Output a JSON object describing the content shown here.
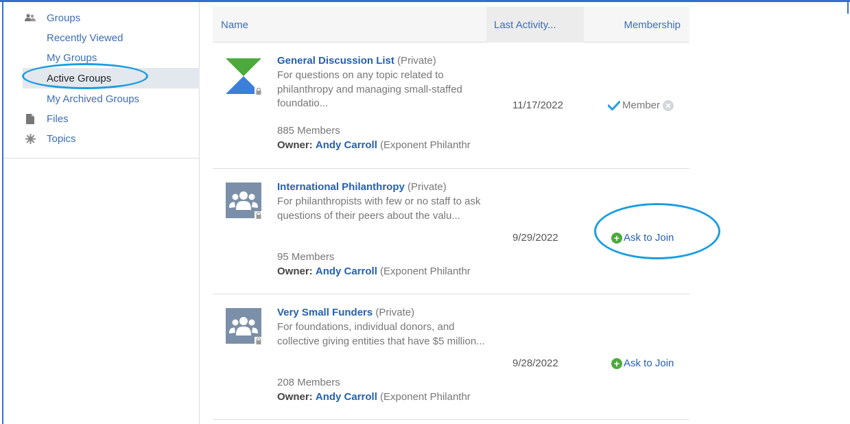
{
  "sidebar": {
    "items": [
      {
        "label": "Groups",
        "icon": "groups-icon"
      },
      {
        "label": "Recently Viewed"
      },
      {
        "label": "My Groups"
      },
      {
        "label": "Active Groups",
        "active": true
      },
      {
        "label": "My Archived Groups"
      },
      {
        "label": "Files",
        "icon": "file-icon"
      },
      {
        "label": "Topics",
        "icon": "topics-icon"
      }
    ]
  },
  "table": {
    "headers": {
      "name": "Name",
      "last_activity": "Last Activity...",
      "membership": "Membership"
    },
    "rows": [
      {
        "title": "General Discussion List",
        "privacy": "(Private)",
        "description": "For questions on any topic related to philanthropy and managing small-staffed foundatio...",
        "members": "885 Members",
        "owner_label": "Owner:",
        "owner_name": "Andy Carroll",
        "owner_org": "(Exponent Philanthr",
        "last_activity": "11/17/2022",
        "membership": "Member",
        "avatar": "hourglass-logo"
      },
      {
        "title": "International Philanthropy",
        "privacy": "(Private)",
        "description": "For philanthropists with few or no staff to ask questions of their peers about the valu...",
        "members": "95 Members",
        "owner_label": "Owner:",
        "owner_name": "Andy Carroll",
        "owner_org": "(Exponent Philanthr",
        "last_activity": "9/29/2022",
        "membership": "Ask to Join",
        "avatar": "group-avatar"
      },
      {
        "title": "Very Small Funders",
        "privacy": "(Private)",
        "description": "For foundations, individual donors, and collective giving entities that have $5 million...",
        "members": "208 Members",
        "owner_label": "Owner:",
        "owner_name": "Andy Carroll",
        "owner_org": "(Exponent Philanthr",
        "last_activity": "9/28/2022",
        "membership": "Ask to Join",
        "avatar": "group-avatar"
      }
    ]
  },
  "colors": {
    "link": "#3c6db4",
    "highlight": "#1a9ee0",
    "join_plus": "#4caa3c",
    "avatar_bg": "#7b8fa8"
  }
}
